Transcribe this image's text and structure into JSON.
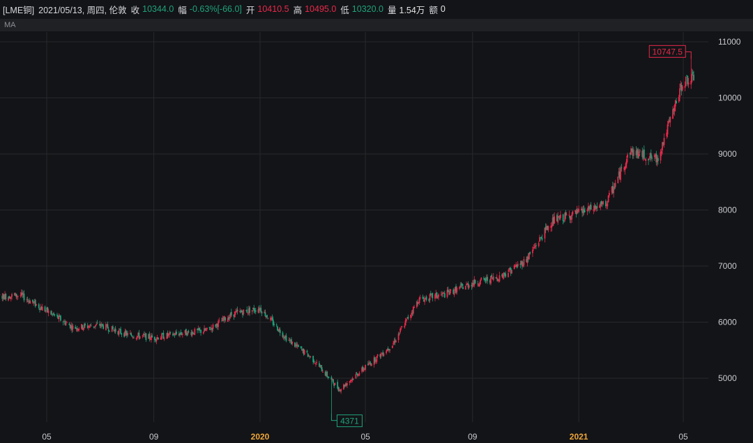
{
  "header": {
    "symbol": "[LME铜]",
    "date": "2021/05/13, 周四, 伦敦",
    "close_label": "收",
    "close_value": "10344.0",
    "change_label": "幅",
    "change_pct": "-0.63%",
    "change_abs": "[-66.0]",
    "open_label": "开",
    "open_value": "10410.5",
    "high_label": "高",
    "high_value": "10495.0",
    "low_label": "低",
    "low_value": "10320.0",
    "volume_label": "量",
    "volume_value": "1.54万",
    "amount_label": "额",
    "amount_value": "0"
  },
  "indicator": {
    "label": "MA"
  },
  "colors": {
    "background": "#131417",
    "up": "#e8294b",
    "down": "#1fa37a",
    "grid": "#26282c",
    "axis_text": "#c8c9cc",
    "year_text": "#f0a63a"
  },
  "chart_data": {
    "type": "candlestick",
    "ylim": [
      4200,
      11000
    ],
    "yticks": [
      5000,
      6000,
      7000,
      8000,
      9000,
      10000,
      11000
    ],
    "ytick_labels": [
      "5000",
      "6000",
      "7000",
      "8000",
      "9000",
      "10000",
      "11000"
    ],
    "xticks": [
      {
        "label": "05",
        "date": "2019-05",
        "year": false
      },
      {
        "label": "09",
        "date": "2019-09",
        "year": false
      },
      {
        "label": "2020",
        "date": "2020-01",
        "year": true
      },
      {
        "label": "05",
        "date": "2020-05",
        "year": false
      },
      {
        "label": "09",
        "date": "2020-09",
        "year": false
      },
      {
        "label": "2021",
        "date": "2021-01",
        "year": true
      },
      {
        "label": "05",
        "date": "2021-05",
        "year": false
      }
    ],
    "x_range": [
      "2019-02",
      "2021-06"
    ],
    "grid": true,
    "trend_points": [
      {
        "date": "2019-02",
        "price": 6400
      },
      {
        "date": "2019-03",
        "price": 6450
      },
      {
        "date": "2019-04",
        "price": 6480
      },
      {
        "date": "2019-05",
        "price": 6200
      },
      {
        "date": "2019-06",
        "price": 5900
      },
      {
        "date": "2019-07",
        "price": 5950
      },
      {
        "date": "2019-08",
        "price": 5780
      },
      {
        "date": "2019-09",
        "price": 5720
      },
      {
        "date": "2019-10",
        "price": 5800
      },
      {
        "date": "2019-11",
        "price": 5850
      },
      {
        "date": "2019-12",
        "price": 6150
      },
      {
        "date": "2020-01",
        "price": 6250
      },
      {
        "date": "2020-02",
        "price": 5700
      },
      {
        "date": "2020-03",
        "price": 5350
      },
      {
        "date": "2020-04",
        "price": 4800
      },
      {
        "date": "2020-05",
        "price": 5200
      },
      {
        "date": "2020-06",
        "price": 5600
      },
      {
        "date": "2020-07",
        "price": 6400
      },
      {
        "date": "2020-08",
        "price": 6500
      },
      {
        "date": "2020-09",
        "price": 6700
      },
      {
        "date": "2020-10",
        "price": 6800
      },
      {
        "date": "2020-11",
        "price": 7100
      },
      {
        "date": "2020-12",
        "price": 7800
      },
      {
        "date": "2021-01",
        "price": 7950
      },
      {
        "date": "2021-02",
        "price": 8100
      },
      {
        "date": "2021-03",
        "price": 9050
      },
      {
        "date": "2021-04",
        "price": 8900
      },
      {
        "date": "2021-05",
        "price": 10300
      },
      {
        "date": "2021-05-13",
        "price": 10344
      }
    ],
    "max_marker": {
      "label": "10747.5",
      "date": "2021-05-10",
      "price": 10747.5
    },
    "min_marker": {
      "label": "4371",
      "date": "2020-03-23",
      "price": 4371
    }
  }
}
